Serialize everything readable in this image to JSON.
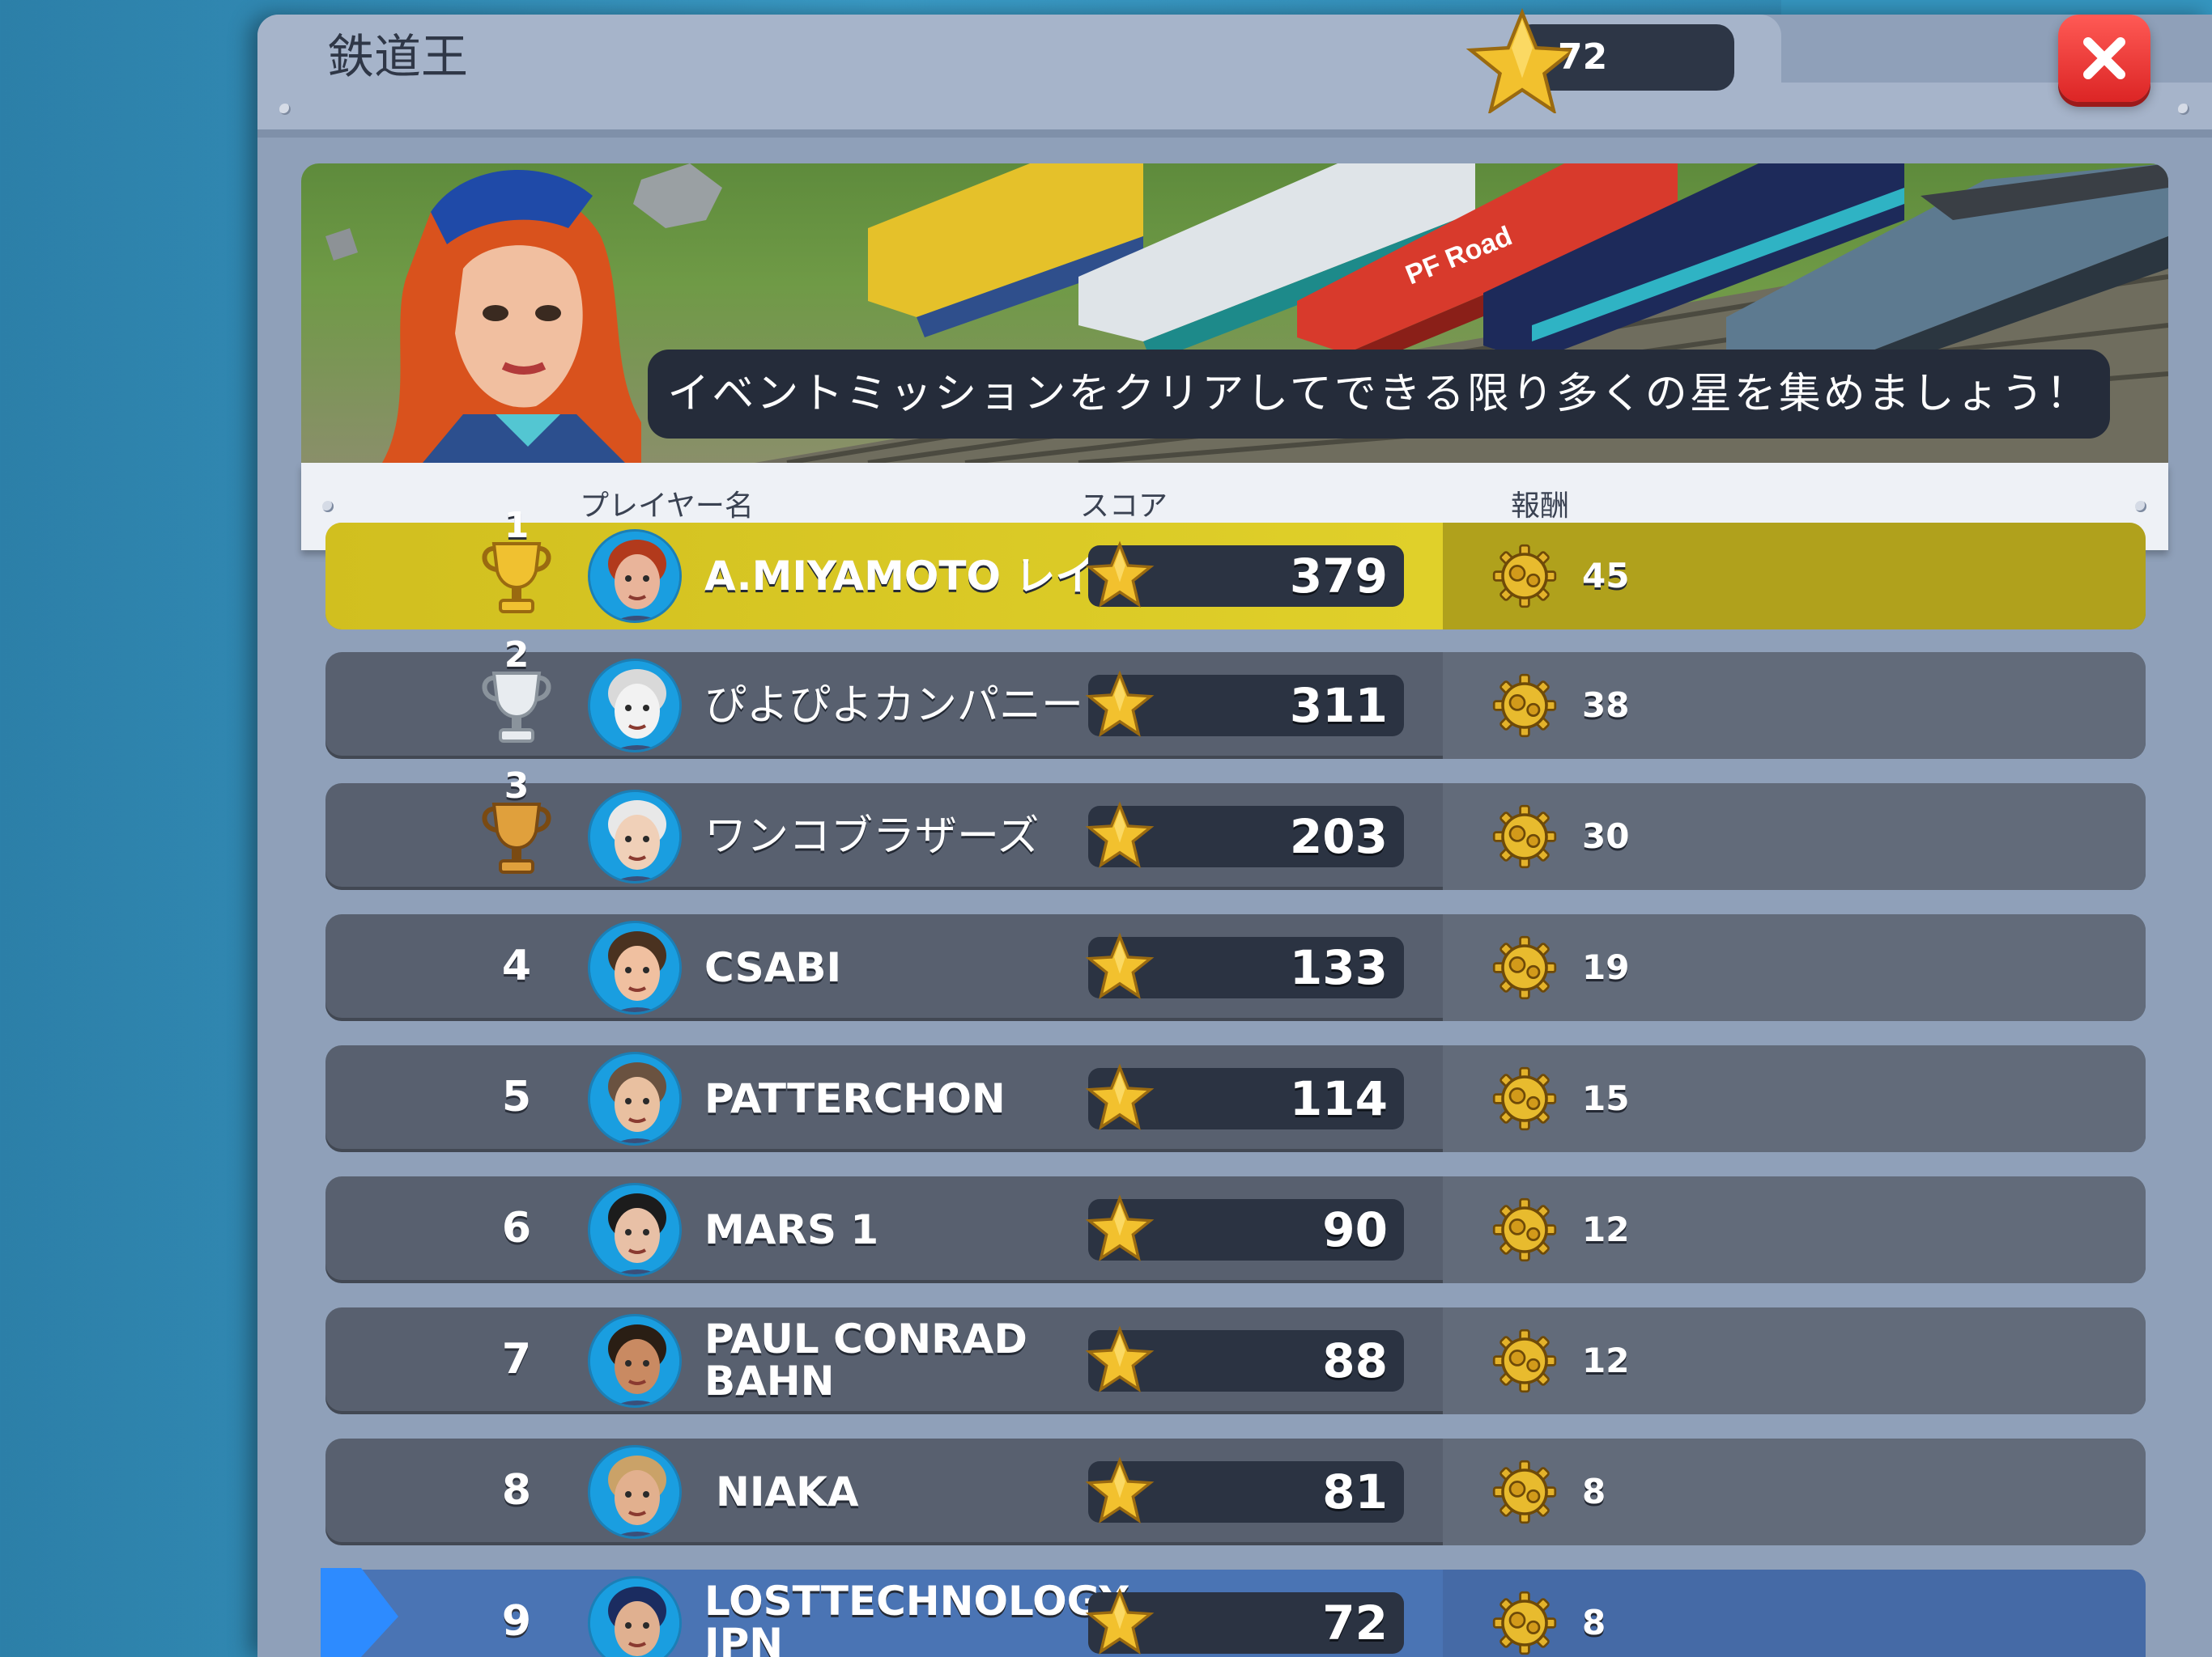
{
  "header": {
    "title": "鉄道王",
    "star_count": "72",
    "close_icon": "close-icon"
  },
  "banner": {
    "caption": "イベントミッションをクリアしてできる限り多くの星を集めましょう！",
    "train_label": "PF Road"
  },
  "columns": {
    "player": "プレイヤー名",
    "score": "スコア",
    "reward": "報酬"
  },
  "rows": [
    {
      "rank": "1",
      "name": "A.MIYAMOTO レイ",
      "score": "379",
      "reward": "45",
      "trophy": "gold",
      "highlight": "gold"
    },
    {
      "rank": "2",
      "name": "ぴよぴよカンパニー",
      "score": "311",
      "reward": "38",
      "trophy": "silver"
    },
    {
      "rank": "3",
      "name": "ワンコブラザーズ",
      "score": "203",
      "reward": "30",
      "trophy": "bronze"
    },
    {
      "rank": "4",
      "name": "CSABI",
      "score": "133",
      "reward": "19"
    },
    {
      "rank": "5",
      "name": "PATTERCHON",
      "score": "114",
      "reward": "15"
    },
    {
      "rank": "6",
      "name": "MARS 1",
      "score": "90",
      "reward": "12"
    },
    {
      "rank": "7",
      "name": "PAUL CONRAD BAHN",
      "name_line1": "PAUL CONRAD",
      "name_line2": "BAHN",
      "score": "88",
      "reward": "12"
    },
    {
      "rank": "8",
      "name": "NIAKA",
      "score": "81",
      "reward": "8"
    },
    {
      "rank": "9",
      "name": "LOSTTECHNOLOGY JPN",
      "name_line1": "LOSTTECHNOLOGY",
      "name_line2": "JPN",
      "score": "72",
      "reward": "8",
      "highlight": "me"
    }
  ],
  "colors": {
    "gold_row": "#d1bf1f",
    "player_row": "#4a74b4",
    "default_row": "#58606f",
    "close_button": "#e63a36"
  }
}
